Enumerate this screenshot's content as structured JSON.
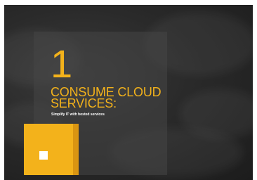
{
  "slide": {
    "number": "1",
    "heading_line1": "CONSUME CLOUD",
    "heading_line2": "SERVICES:",
    "subheading": "Simplify IT with hosted services"
  },
  "colors": {
    "accent": "#f3b21b",
    "accent_dark": "#d99512",
    "background": "#2a2a2a",
    "panel": "#464646"
  },
  "icons": [
    "square-icon"
  ]
}
